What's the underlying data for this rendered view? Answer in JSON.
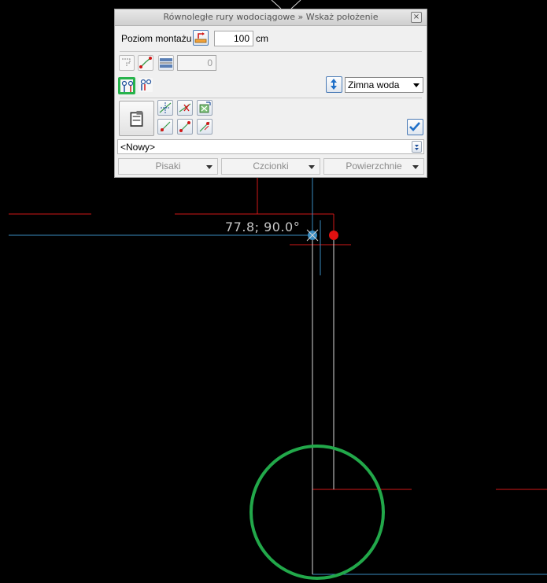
{
  "panel": {
    "title": "Równoległe rury wodociągowe » Wskaż położenie",
    "close_glyph": "×",
    "mounting_label": "Poziom montażu",
    "mounting_value": "100",
    "mounting_unit": "cm",
    "count_value": "0",
    "medium_selected": "Zimna woda",
    "style_selected": "<Nowy>",
    "tabs": [
      {
        "label": "Pisaki"
      },
      {
        "label": "Czcionki"
      },
      {
        "label": "Powierzchnie"
      }
    ]
  },
  "cad": {
    "coordinate_readout": "77.8;  90.0°"
  },
  "colors": {
    "background": "#000000",
    "red_line": "#d01818",
    "blue_line": "#3a8cc0",
    "white_line": "#d8d8d8",
    "green_circle": "#22a84a",
    "selection_green": "#27b34b",
    "red_point": "#e01010"
  },
  "icons": [
    "layer-icon",
    "path-icon",
    "parallel-lines-icon",
    "pipe-pair-icon",
    "pipe-offset-icon",
    "swap-arrows-icon",
    "properties-icon",
    "snap-icon",
    "trim-icon",
    "extend-icon",
    "line-start-icon",
    "line-mid-icon",
    "line-end-icon",
    "confirm-check-icon",
    "scroll-icon",
    "chevron-down-icon",
    "close-icon"
  ]
}
